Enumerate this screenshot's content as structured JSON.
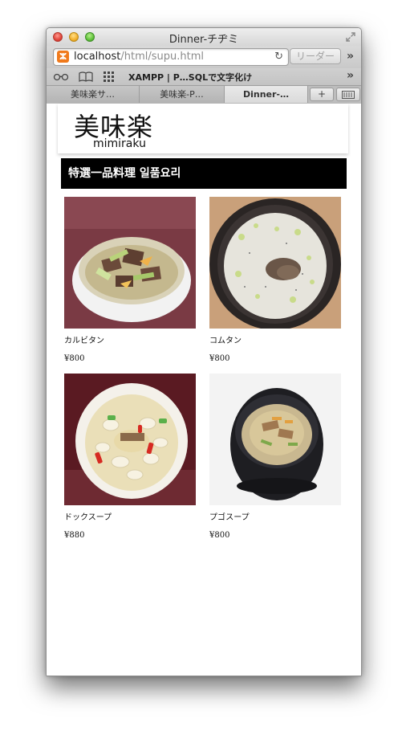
{
  "window": {
    "title": "Dinner-チヂミ"
  },
  "address_bar": {
    "url_host": "localhost",
    "url_path": "/html/supu.html",
    "reader_label": "リーダー"
  },
  "bookmarks": {
    "items": [
      "XAMPP | P…SQLで文字化け"
    ]
  },
  "tabs": [
    {
      "label": "美味楽サ…",
      "active": false
    },
    {
      "label": "美味楽-P…",
      "active": false
    },
    {
      "label": "Dinner-…",
      "active": true
    }
  ],
  "tab_buttons": {
    "new_tab": "+"
  },
  "site": {
    "logo_kanji": "美味楽",
    "logo_roman": "mimiraku"
  },
  "category": {
    "title": "特選一品料理 일품요리"
  },
  "products": [
    {
      "name": "カルビタン",
      "price": "¥800",
      "photo": "galbitang-soup"
    },
    {
      "name": "コムタン",
      "price": "¥800",
      "photo": "gomtang-soup"
    },
    {
      "name": "ドックスープ",
      "price": "¥880",
      "photo": "tteok-soup"
    },
    {
      "name": "プゴスープ",
      "price": "¥800",
      "photo": "bugeo-soup"
    }
  ],
  "icons": {
    "favicon": "xampp-icon",
    "reload": "reload-icon",
    "reading_list": "glasses-icon",
    "bookmarks": "book-icon",
    "top_sites": "grid-icon"
  }
}
